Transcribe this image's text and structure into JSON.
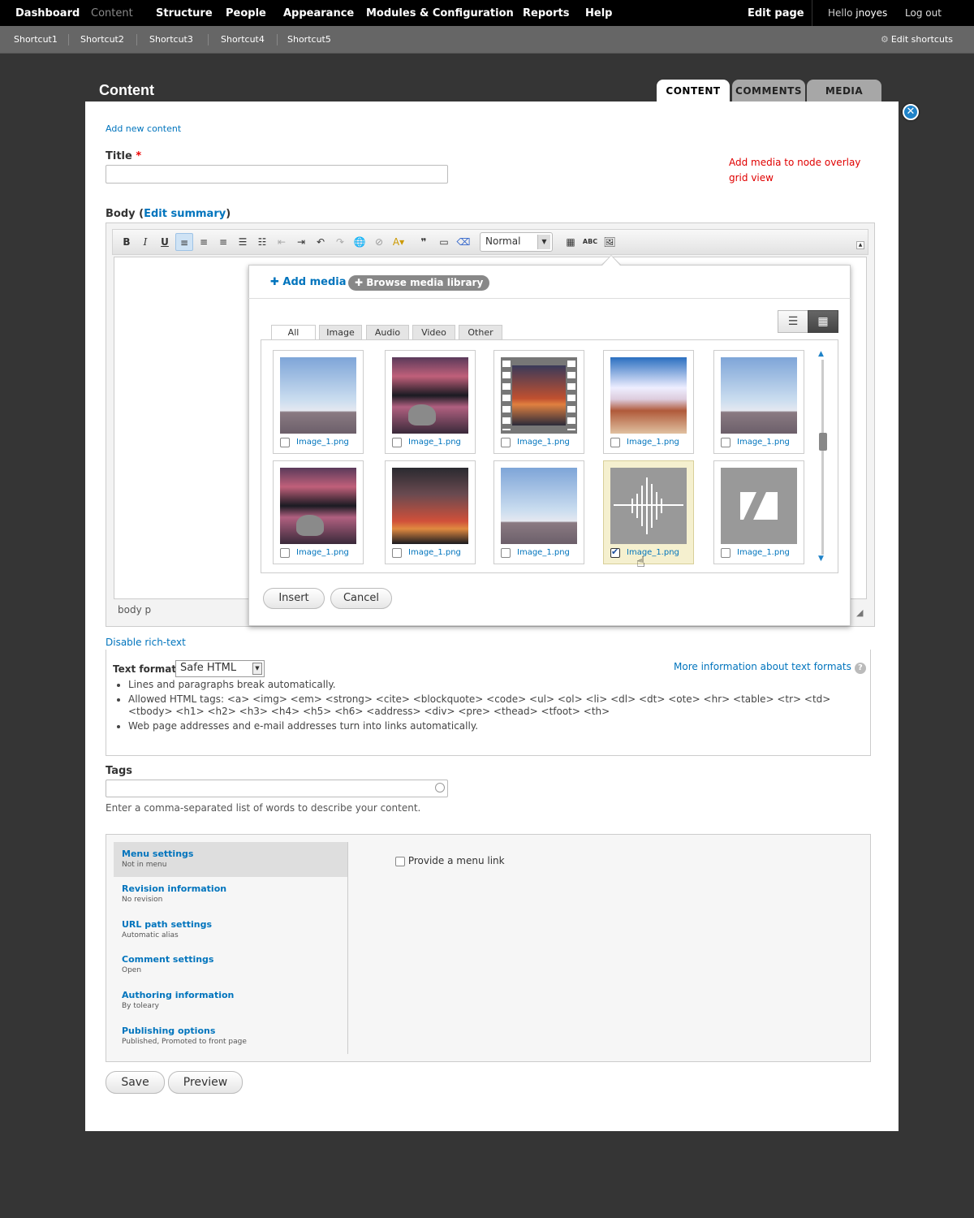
{
  "toolbar": {
    "items": [
      "Dashboard",
      "Content",
      "Structure",
      "People",
      "Appearance",
      "Modules & Configuration",
      "Reports",
      "Help"
    ],
    "edit_page": "Edit page",
    "hello_prefix": "Hello",
    "user": "jnoyes",
    "logout": "Log out"
  },
  "shortcuts": {
    "items": [
      "Shortcut1",
      "Shortcut2",
      "Shortcut3",
      "Shortcut4",
      "Shortcut5"
    ],
    "edit": "Edit shortcuts"
  },
  "page": {
    "title": "Content",
    "tabs": [
      "CONTENT",
      "COMMENTS",
      "MEDIA"
    ]
  },
  "form": {
    "add_new": "Add new content",
    "title_label": "Title",
    "required_mark": "*",
    "body_label": "Body",
    "edit_summary": "Edit summary",
    "annotation": "Add media to node overlay grid view",
    "disable_rich": "Disable rich-text",
    "editor_format": "Normal",
    "editor_status": "body  p"
  },
  "media": {
    "add_media": "Add media",
    "browse": "Browse media library",
    "tabs": [
      "All",
      "Image",
      "Audio",
      "Video",
      "Other"
    ],
    "items": [
      {
        "label": "Image_1.png",
        "kind": "sky"
      },
      {
        "label": "Image_1.png",
        "kind": "lake"
      },
      {
        "label": "Image_1.png",
        "kind": "film"
      },
      {
        "label": "Image_1.png",
        "kind": "cloud"
      },
      {
        "label": "Image_1.png",
        "kind": "sky"
      },
      {
        "label": "Image_1.png",
        "kind": "lake"
      },
      {
        "label": "Image_1.png",
        "kind": "sunset"
      },
      {
        "label": "Image_1.png",
        "kind": "sky"
      },
      {
        "label": "Image_1.png",
        "kind": "audio",
        "checked": true
      },
      {
        "label": "Image_1.png",
        "kind": "doc"
      }
    ],
    "insert": "Insert",
    "cancel": "Cancel"
  },
  "text_format": {
    "label": "Text format",
    "value": "Safe HTML",
    "more_info": "More information about text formats",
    "bullets": [
      "Lines and paragraphs break automatically.",
      "Allowed HTML tags: <a> <img> <em> <strong> <cite> <blockquote> <code> <ul> <ol> <li> <dl> <dt> <ote> <hr> <table> <tr> <td> <tbody> <h1> <h2> <h3> <h4> <h5> <h6> <address> <div> <pre> <thead> <tfoot> <th>",
      "Web page addresses and e-mail addresses turn into links automatically."
    ]
  },
  "tags": {
    "label": "Tags",
    "help": "Enter a comma-separated list of words to describe your content."
  },
  "settings": {
    "tabs": [
      {
        "title": "Menu settings",
        "summary": "Not in menu"
      },
      {
        "title": "Revision information",
        "summary": "No revision"
      },
      {
        "title": "URL path settings",
        "summary": "Automatic alias"
      },
      {
        "title": "Comment settings",
        "summary": "Open"
      },
      {
        "title": "Authoring information",
        "summary": "By toleary"
      },
      {
        "title": "Publishing options",
        "summary": "Published, Promoted to front page"
      }
    ],
    "menu_link": "Provide a menu link"
  },
  "actions": {
    "save": "Save",
    "preview": "Preview"
  }
}
